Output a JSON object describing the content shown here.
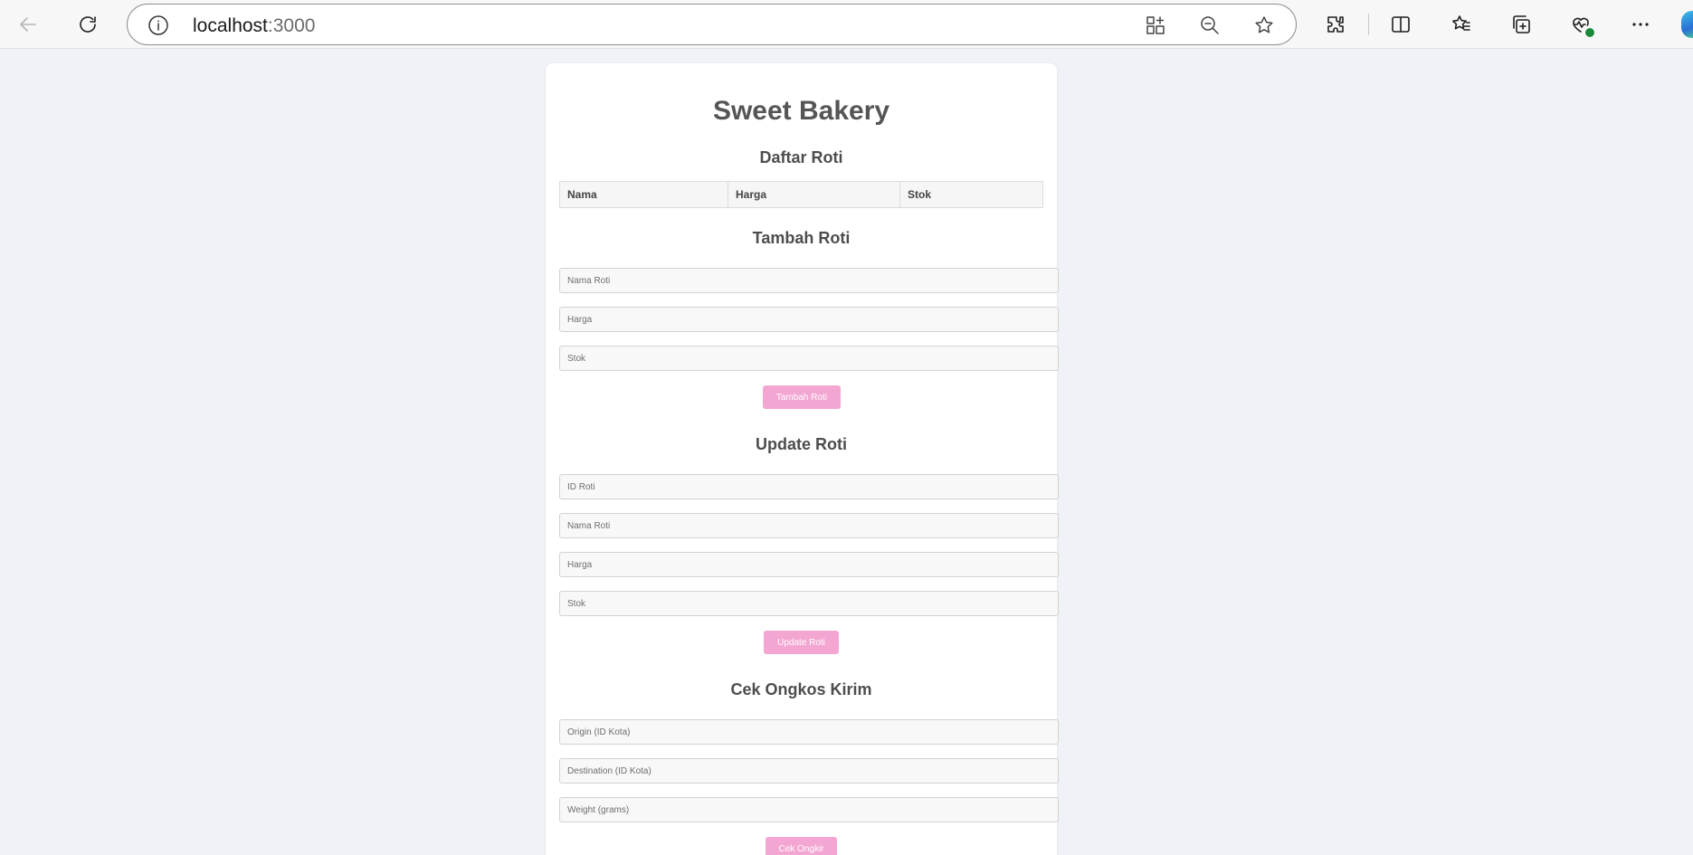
{
  "browser": {
    "url_host": "localhost",
    "url_port": ":3000"
  },
  "page": {
    "title": "Sweet Bakery",
    "list_section": {
      "heading": "Daftar Roti",
      "columns": [
        "Nama",
        "Harga",
        "Stok"
      ]
    },
    "add_section": {
      "heading": "Tambah Roti",
      "fields": [
        "Nama Roti",
        "Harga",
        "Stok"
      ],
      "button": "Tambah Roti"
    },
    "update_section": {
      "heading": "Update Roti",
      "fields": [
        "ID Roti",
        "Nama Roti",
        "Harga",
        "Stok"
      ],
      "button": "Update Roti"
    },
    "shipping_section": {
      "heading": "Cek Ongkos Kirim",
      "fields": [
        "Origin (ID Kota)",
        "Destination (ID Kota)",
        "Weight (grams)"
      ],
      "button": "Cek Ongkir"
    }
  }
}
